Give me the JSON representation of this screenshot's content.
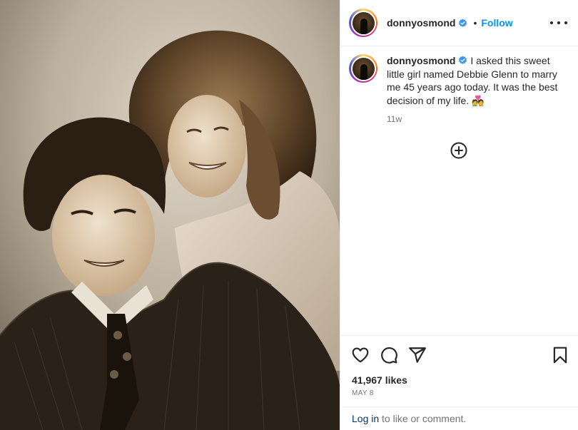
{
  "post": {
    "username": "donnyosmond",
    "follow_label": "Follow",
    "separator": "•",
    "caption": "I asked this sweet little girl named Debbie Glenn to marry me 45 years ago today. It was the best decision of my life.",
    "caption_emoji": "💑",
    "time_ago": "11w",
    "likes": "41,967 likes",
    "date": "MAY 8",
    "login_link": "Log in",
    "login_suffix": " to like or comment."
  },
  "icons": {
    "verified": "verified-badge-icon",
    "more": "more-options-icon",
    "add_comment": "add-comment-icon",
    "like": "heart-icon",
    "comment": "comment-icon",
    "share": "share-icon",
    "save": "bookmark-icon"
  },
  "colors": {
    "follow": "#0095f6",
    "verified": "#3897f0",
    "login_link": "#00376b",
    "muted": "#737373"
  }
}
